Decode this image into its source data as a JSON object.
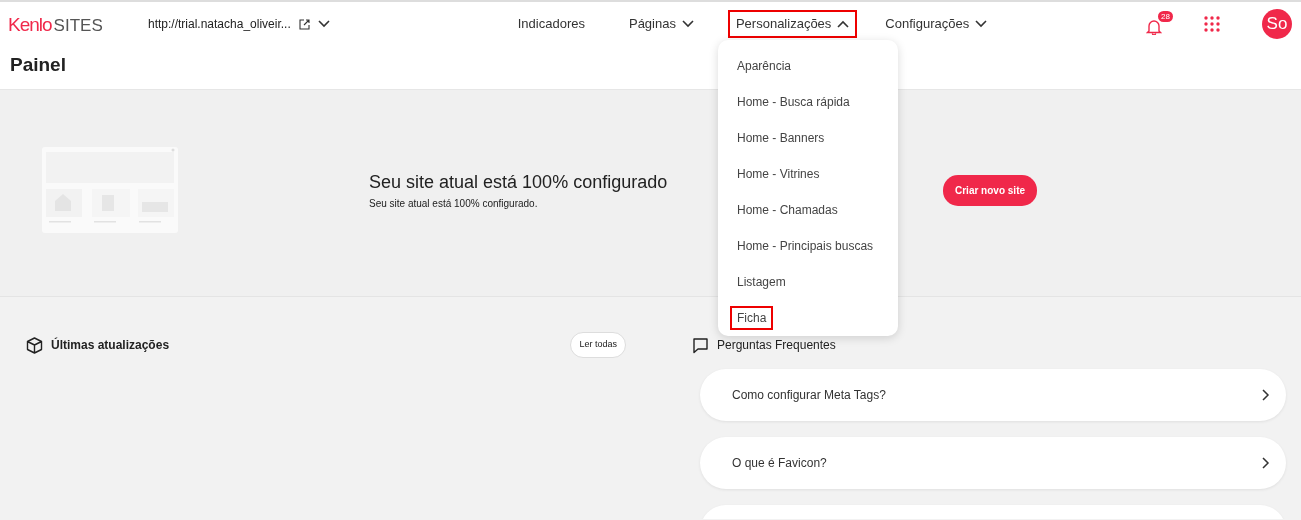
{
  "header": {
    "logo": {
      "brand": "Kenlo",
      "product": "SITES"
    },
    "site_url": "http://trial.natacha_oliveir...",
    "nav": [
      {
        "label": "Indicadores",
        "kind": "link",
        "highlighted": false
      },
      {
        "label": "Páginas",
        "kind": "menu",
        "expanded": false,
        "highlighted": false
      },
      {
        "label": "Personalizações",
        "kind": "menu",
        "expanded": true,
        "highlighted": true
      },
      {
        "label": "Configurações",
        "kind": "menu",
        "expanded": false,
        "highlighted": false
      }
    ],
    "notification_count": "28",
    "avatar": "So"
  },
  "dropdown_menu": [
    {
      "label": "Aparência",
      "highlighted": false
    },
    {
      "label": "Home - Busca rápida",
      "highlighted": false
    },
    {
      "label": "Home - Banners",
      "highlighted": false
    },
    {
      "label": "Home - Vitrines",
      "highlighted": false
    },
    {
      "label": "Home - Chamadas",
      "highlighted": false
    },
    {
      "label": "Home - Principais buscas",
      "highlighted": false
    },
    {
      "label": "Listagem",
      "highlighted": false
    },
    {
      "label": "Ficha",
      "highlighted": true
    }
  ],
  "page_title": "Painel",
  "hero": {
    "title": "Seu site atual está 100% configurado",
    "subtitle": "Seu site atual está 100% configurado.",
    "button": "Criar novo site"
  },
  "updates": {
    "title": "Últimas atualizações",
    "button": "Ler todas"
  },
  "faq": {
    "title": "Perguntas Frequentes",
    "items": [
      {
        "question": "Como configurar Meta Tags?"
      },
      {
        "question": "O que é Favicon?"
      }
    ]
  }
}
